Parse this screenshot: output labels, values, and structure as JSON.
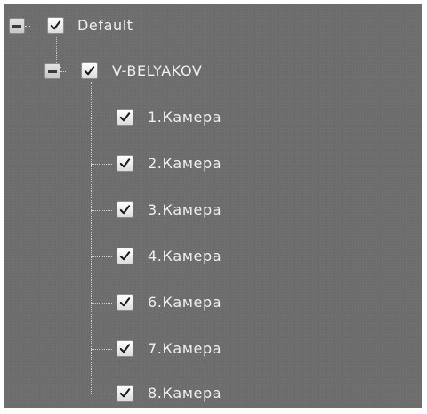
{
  "tree": {
    "root": {
      "label": "Default",
      "expanded": true,
      "checked": true,
      "server": {
        "label": "V-BELYAKOV",
        "expanded": true,
        "checked": true,
        "cameras": [
          {
            "label": "1.Камера",
            "checked": true
          },
          {
            "label": "2.Камера",
            "checked": true
          },
          {
            "label": "3.Камера",
            "checked": true
          },
          {
            "label": "4.Камера",
            "checked": true
          },
          {
            "label": "6.Камера",
            "checked": true
          },
          {
            "label": "7.Камера",
            "checked": true
          },
          {
            "label": "8.Камера",
            "checked": true
          }
        ]
      }
    }
  },
  "icons": {
    "expander": "minus-icon",
    "checkbox": "checkmark-icon"
  },
  "colors": {
    "panel_background": "#6d6d6d",
    "label_text": "#f0f0f0",
    "checkmark": "#1a1a1a",
    "connector_lines": "#d0d0d0"
  }
}
